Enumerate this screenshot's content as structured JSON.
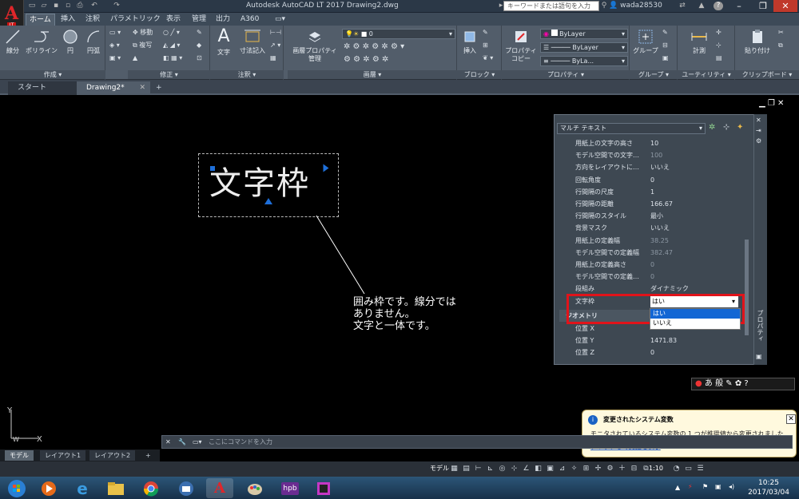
{
  "app": {
    "title": "Autodesk AutoCAD LT 2017    Drawing2.dwg",
    "logo_letter": "A",
    "logo_sub": "LT",
    "search_placeholder": "キーワードまたは語句を入力",
    "username": "wada28530"
  },
  "menu_tabs": [
    "ホーム",
    "挿入",
    "注釈",
    "パラメトリック",
    "表示",
    "管理",
    "出力",
    "A360"
  ],
  "ribbon": {
    "draw": {
      "label": "作成",
      "line": "線分",
      "polyline": "ポリライン",
      "circle": "円",
      "arc": "円弧"
    },
    "modify": {
      "label": "修正",
      "move": "移動",
      "copy": "複写"
    },
    "annotation": {
      "label": "注釈",
      "text": "文字",
      "dimension": "寸法記入"
    },
    "layers": {
      "label": "画層",
      "layer_props_1": "画層プロパティ",
      "layer_props_2": "管理",
      "current_layer": "0"
    },
    "block": {
      "label": "ブロック",
      "insert": "挿入"
    },
    "properties": {
      "label": "プロパティ",
      "match_1": "プロパティ",
      "match_2": "コピー",
      "color": "ByLayer",
      "linetype": "ByLayer",
      "lineweight": "ByLa..."
    },
    "groups": {
      "label": "グループ",
      "group": "グループ"
    },
    "utilities": {
      "label": "ユーティリティ",
      "measure": "計測"
    },
    "clipboard": {
      "label": "クリップボード",
      "paste": "貼り付け"
    }
  },
  "doc_tabs": [
    "スタート",
    "Drawing2*"
  ],
  "canvas": {
    "mtext": "文字枠",
    "note_lines": [
      "囲み枠です。線分では",
      "ありません。",
      "文字と一体です。"
    ]
  },
  "properties_palette": {
    "object_type": "マルチ テキスト",
    "rows": [
      {
        "key": "用紙上の文字の高さ",
        "value": "10",
        "dim": false
      },
      {
        "key": "モデル空間での文字…",
        "value": "100",
        "dim": true
      },
      {
        "key": "方向をレイアウトに…",
        "value": "いいえ",
        "dim": false
      },
      {
        "key": "回転角度",
        "value": "0",
        "dim": false
      },
      {
        "key": "行間隔の尺度",
        "value": "1",
        "dim": false
      },
      {
        "key": "行間隔の距離",
        "value": "166.67",
        "dim": false
      },
      {
        "key": "行間隔のスタイル",
        "value": "最小",
        "dim": false
      },
      {
        "key": "背景マスク",
        "value": "いいえ",
        "dim": false
      },
      {
        "key": "用紙上の定義幅",
        "value": "38.25",
        "dim": true
      },
      {
        "key": "モデル空間での定義幅",
        "value": "382.47",
        "dim": true
      },
      {
        "key": "用紙上の定義高さ",
        "value": "0",
        "dim": true
      },
      {
        "key": "モデル空間での定義…",
        "value": "0",
        "dim": true
      },
      {
        "key": "段組み",
        "value": "ダイナミック",
        "dim": false
      },
      {
        "key": "文字枠",
        "value": "はい",
        "dim": false
      }
    ],
    "geometry_header": "ジオメトリ",
    "geometry_rows": [
      {
        "key": "位置 X",
        "value": ""
      },
      {
        "key": "位置 Y",
        "value": "1471.83"
      },
      {
        "key": "位置 Z",
        "value": "0"
      }
    ],
    "dropdown_options": [
      "はい",
      "いいえ"
    ],
    "side_title": "プロパティ"
  },
  "ime_bar": "あ 般",
  "balloon": {
    "title": "変更されたシステム変数",
    "message": "モニタされているシステム変数の 1 つが推奨値から変更されました",
    "link": "クリックして変更を表示"
  },
  "command_line": {
    "placeholder": "ここにコマンドを入力"
  },
  "layout_tabs": [
    "モデル",
    "レイアウト1",
    "レイアウト2"
  ],
  "status_bar": {
    "model": "モデル",
    "scale": "1:10"
  },
  "clock": {
    "time": "10:25",
    "date": "2017/03/04"
  },
  "colors": {
    "accent": "#1266d4",
    "highlight_border": "#e1131a",
    "ribbon_bg": "#525d6a"
  }
}
